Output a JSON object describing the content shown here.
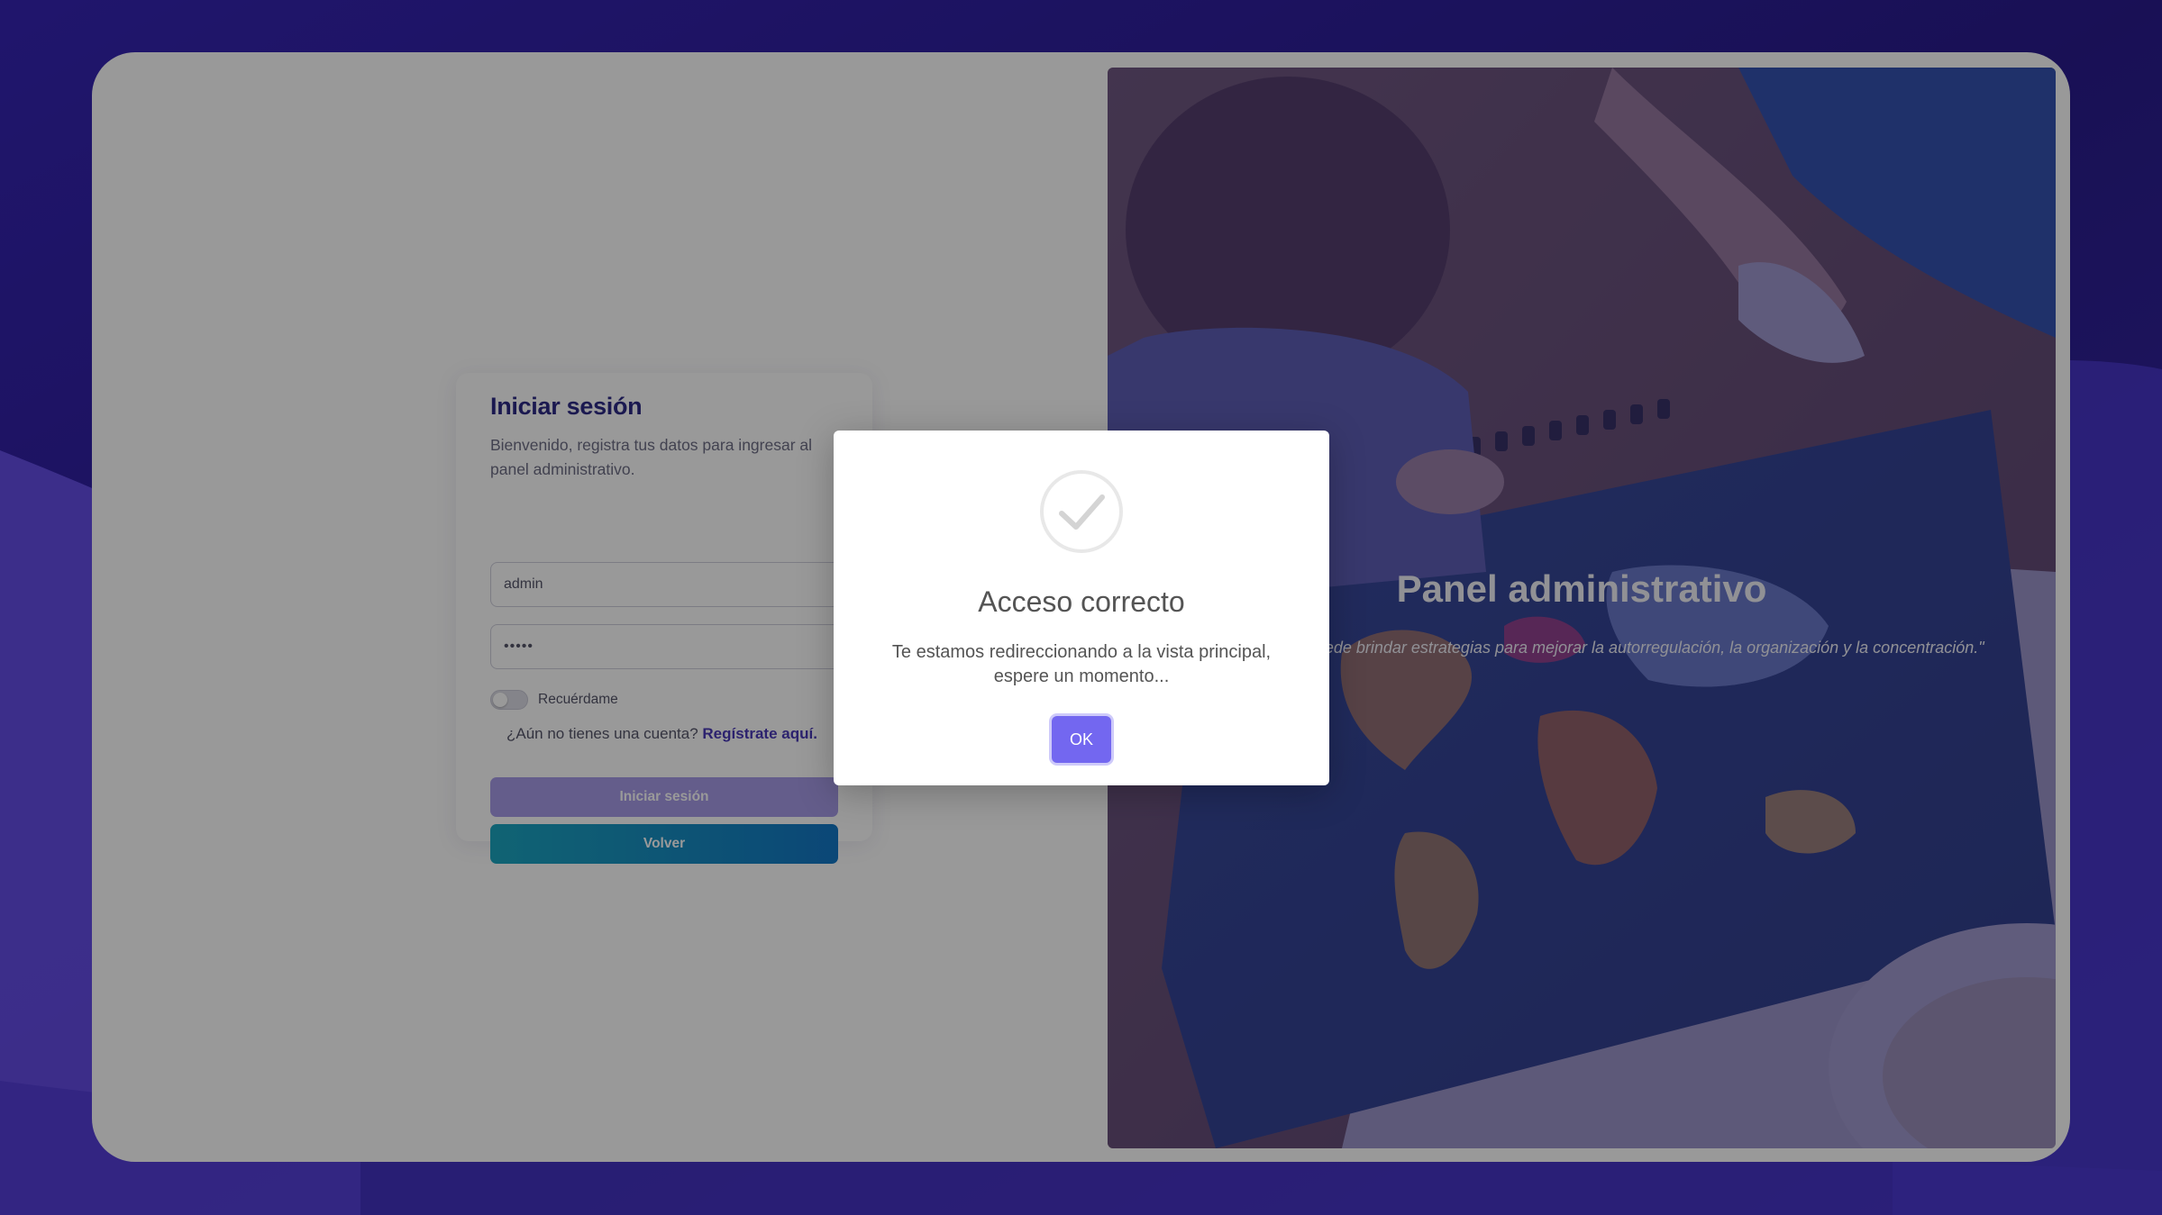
{
  "login": {
    "title": "Iniciar sesión",
    "subtitle": "Bienvenido, registra tus datos para ingresar al panel administrativo.",
    "username_value": "admin",
    "password_value": "•••••",
    "remember_label": "Recuérdame",
    "remember_checked": false,
    "register_prompt": "¿Aún no tienes una cuenta?",
    "register_link": "Regístrate aquí.",
    "login_button": "Iniciar sesión",
    "back_button": "Volver"
  },
  "hero": {
    "title": "Panel administrativo",
    "quote": "\"La plataforma te puede brindar estrategias para mejorar la autorregulación, la organización y la concentración.\"",
    "image_description": "child-with-world-map-photo"
  },
  "modal": {
    "icon": "check-circle-icon",
    "title": "Acceso correcto",
    "message": "Te estamos redireccionando a la vista principal, espere un momento...",
    "ok_button": "OK"
  },
  "colors": {
    "brand_dark": "#2e2b86",
    "brand_accent": "#7367f0",
    "login_button": "#a79be8",
    "back_button": "#1377c6",
    "background": "#3a2aa8"
  }
}
